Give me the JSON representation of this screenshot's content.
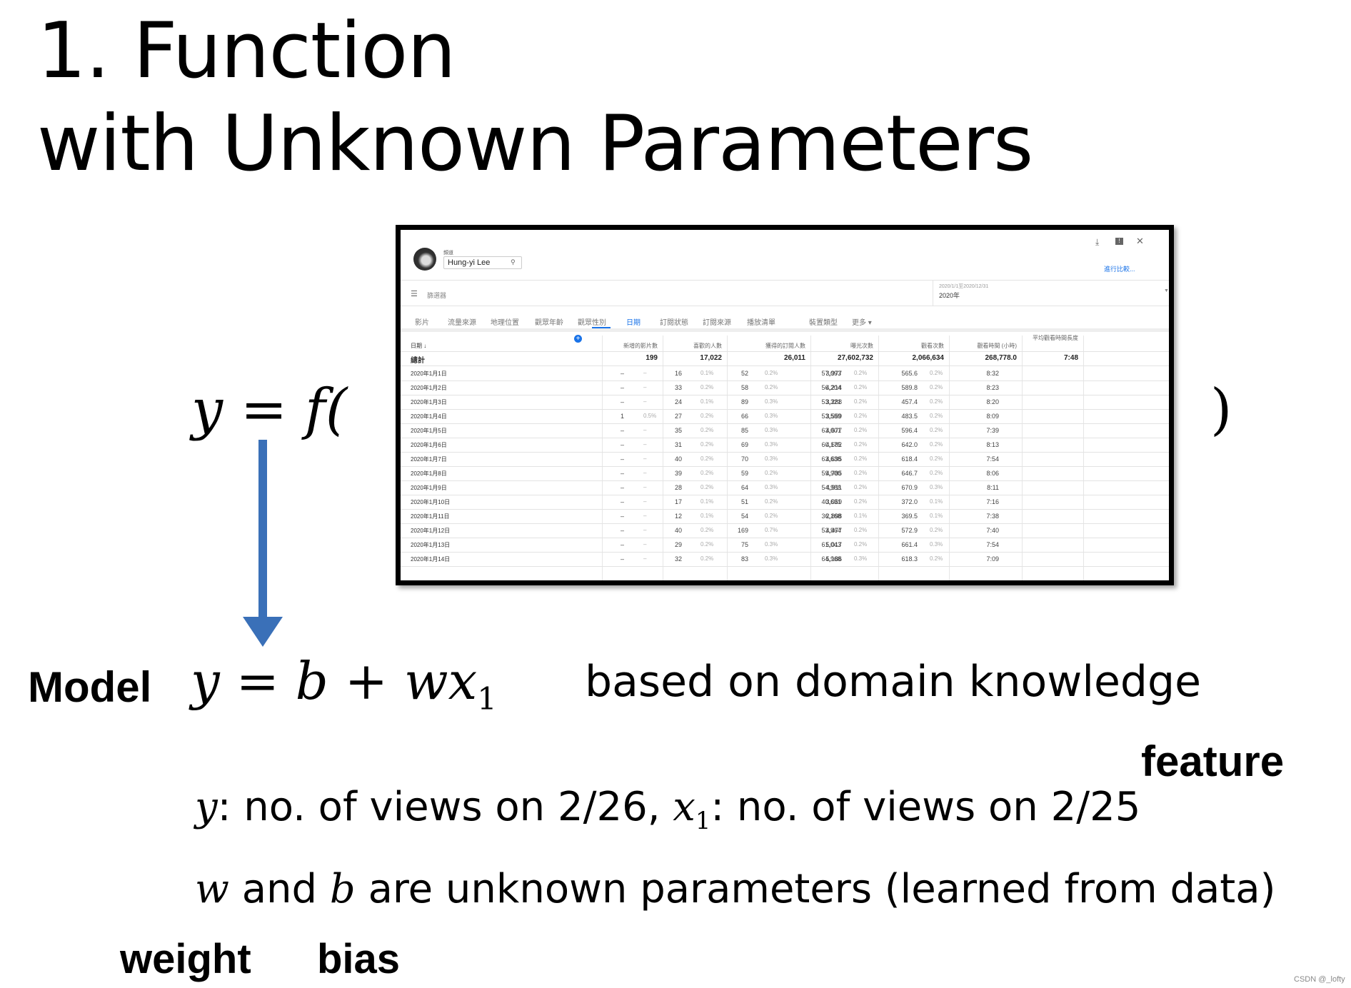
{
  "slide": {
    "title_line1": "1. Function",
    "title_line2": "with Unknown Parameters",
    "eq_left": "y = f(",
    "eq_right": ")",
    "model_label": "Model",
    "model_y": "y",
    "model_eq": " = b + wx",
    "model_sub": "1",
    "domain_note": "based on domain knowledge",
    "feature_label": "feature",
    "def_y": "y",
    "def_y_text": ": no. of views on 2/26, ",
    "def_x": "x",
    "def_x_sub": "1",
    "def_x_text": ": no. of views on 2/25",
    "param_w": "w",
    "param_and": " and ",
    "param_b": "b",
    "param_text": " are unknown parameters (learned from data)",
    "weight_label": "weight",
    "bias_label": "bias",
    "watermark": "CSDN @_lofty",
    "arrow_color": "#3a70b8"
  },
  "analytics": {
    "channel_label": "頻道",
    "channel_value": "Hung-yi Lee",
    "compare_link": "進行比較...",
    "filter_label": "篩選器",
    "date_range": "2020/1/1至2020/12/31",
    "date_value": "2020年",
    "tabs": [
      "影片",
      "流量來源",
      "地理位置",
      "觀眾年齡",
      "觀眾性別",
      "日期",
      "訂閱狀態",
      "訂閱來源",
      "播放清單",
      "裝置類型",
      "更多 ▾"
    ],
    "active_tab": "日期",
    "accent": "#1a73e8",
    "columns": [
      "日期 ↓",
      "新增的影片數",
      "喜歡的人數",
      "獲得的訂閱人數",
      "曝光次數",
      "觀看次數",
      "觀看時間 (小時)",
      "平均觀看時間長度"
    ],
    "totals": {
      "label": "總計",
      "values": [
        "199",
        "17,022",
        "26,011",
        "27,602,732",
        "2,066,634",
        "268,778.0",
        "7:48"
      ]
    },
    "rows": [
      [
        "2020年1月1日",
        "–",
        "–",
        "16",
        "0.1%",
        "52",
        "0.2%",
        "57,093",
        "3,977",
        "0.2%",
        "565.6",
        "0.2%",
        "8:32"
      ],
      [
        "2020年1月2日",
        "–",
        "–",
        "33",
        "0.2%",
        "58",
        "0.2%",
        "56,204",
        "4,214",
        "0.2%",
        "589.8",
        "0.2%",
        "8:23"
      ],
      [
        "2020年1月3日",
        "–",
        "–",
        "24",
        "0.1%",
        "89",
        "0.3%",
        "53,321",
        "3,288",
        "0.2%",
        "457.4",
        "0.2%",
        "8:20"
      ],
      [
        "2020年1月4日",
        "1",
        "0.5%",
        "27",
        "0.2%",
        "66",
        "0.3%",
        "53,599",
        "3,559",
        "0.2%",
        "483.5",
        "0.2%",
        "8:09"
      ],
      [
        "2020年1月5日",
        "–",
        "–",
        "35",
        "0.2%",
        "85",
        "0.3%",
        "63,001",
        "4,677",
        "0.2%",
        "596.4",
        "0.2%",
        "7:39"
      ],
      [
        "2020年1月6日",
        "–",
        "–",
        "31",
        "0.2%",
        "69",
        "0.3%",
        "60,175",
        "4,682",
        "0.2%",
        "642.0",
        "0.2%",
        "8:13"
      ],
      [
        "2020年1月7日",
        "–",
        "–",
        "40",
        "0.2%",
        "70",
        "0.3%",
        "63,638",
        "4,695",
        "0.2%",
        "618.4",
        "0.2%",
        "7:54"
      ],
      [
        "2020年1月8日",
        "–",
        "–",
        "39",
        "0.2%",
        "59",
        "0.2%",
        "59,900",
        "4,785",
        "0.2%",
        "646.7",
        "0.2%",
        "8:06"
      ],
      [
        "2020年1月9日",
        "–",
        "–",
        "28",
        "0.2%",
        "64",
        "0.3%",
        "54,988",
        "4,911",
        "0.2%",
        "670.9",
        "0.3%",
        "8:11"
      ],
      [
        "2020年1月10日",
        "–",
        "–",
        "17",
        "0.1%",
        "51",
        "0.2%",
        "40,631",
        "3,069",
        "0.2%",
        "372.0",
        "0.1%",
        "7:16"
      ],
      [
        "2020年1月11日",
        "–",
        "–",
        "12",
        "0.1%",
        "54",
        "0.2%",
        "36,168",
        "2,898",
        "0.1%",
        "369.5",
        "0.1%",
        "7:38"
      ],
      [
        "2020年1月12日",
        "–",
        "–",
        "40",
        "0.2%",
        "169",
        "0.7%",
        "53,964",
        "4,477",
        "0.2%",
        "572.9",
        "0.2%",
        "7:40"
      ],
      [
        "2020年1月13日",
        "–",
        "–",
        "29",
        "0.2%",
        "75",
        "0.3%",
        "61,043",
        "5,017",
        "0.2%",
        "661.4",
        "0.3%",
        "7:54"
      ],
      [
        "2020年1月14日",
        "–",
        "–",
        "32",
        "0.2%",
        "83",
        "0.3%",
        "64,968",
        "5,186",
        "0.3%",
        "618.3",
        "0.2%",
        "7:09"
      ]
    ]
  }
}
